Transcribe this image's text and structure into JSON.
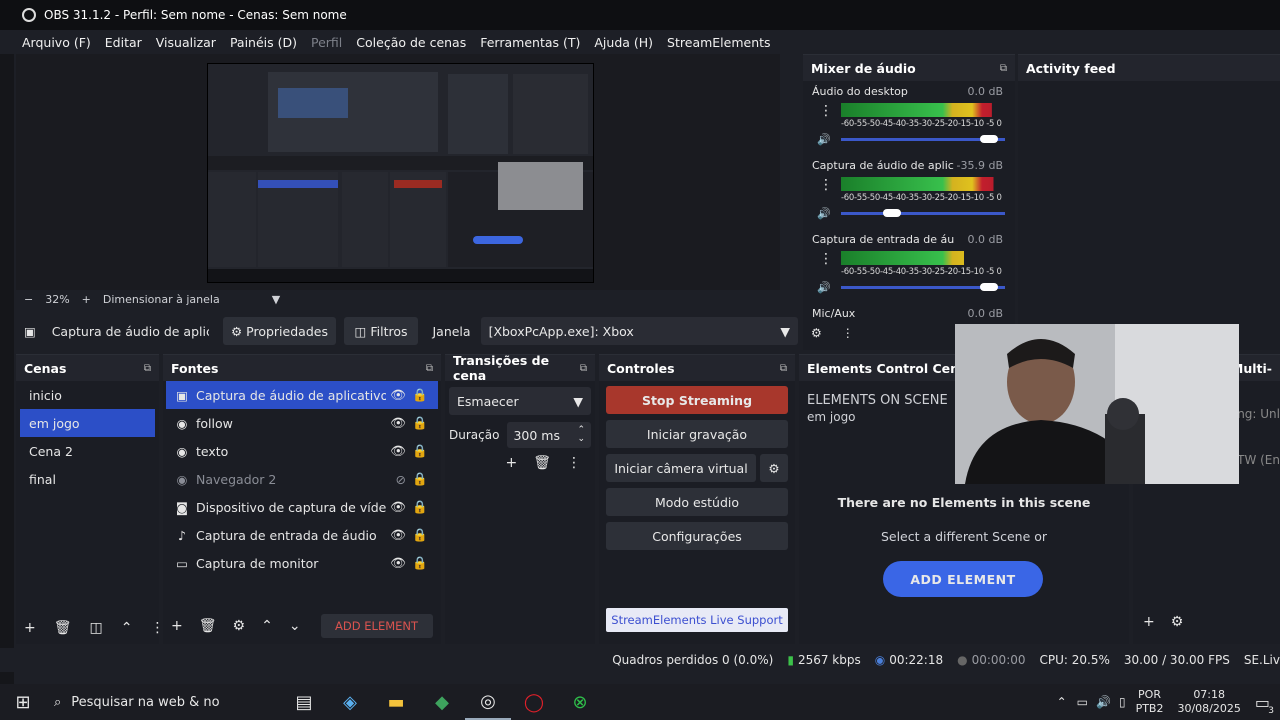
{
  "window": {
    "title": "OBS 31.1.2 - Perfil: Sem nome - Cenas: Sem nome"
  },
  "menu": [
    {
      "label": "Arquivo (F)",
      "disabled": false
    },
    {
      "label": "Editar",
      "disabled": false
    },
    {
      "label": "Visualizar",
      "disabled": false
    },
    {
      "label": "Painéis (D)",
      "disabled": false
    },
    {
      "label": "Perfil",
      "disabled": true
    },
    {
      "label": "Coleção de cenas",
      "disabled": false
    },
    {
      "label": "Ferramentas (T)",
      "disabled": false
    },
    {
      "label": "Ajuda (H)",
      "disabled": false
    },
    {
      "label": "StreamElements",
      "disabled": false
    }
  ],
  "zoom": {
    "minus": "−",
    "value": "32%",
    "plus": "+",
    "fit": "Dimensionar à janela"
  },
  "sourcebar": {
    "source_name": "Captura de áudio de aplicat",
    "properties": "Propriedades",
    "filters": "Filtros",
    "window_label": "Janela",
    "window_value": "[XboxPcApp.exe]: Xbox"
  },
  "mixer": {
    "title": "Mixer de áudio",
    "scale": "-60-55-50-45-40-35-30-25-20-15-10 -5  0",
    "tracks": [
      {
        "name": "Áudio do desktop",
        "db": "0.0 dB",
        "level": 0.92,
        "volume": 0.92,
        "muted": false
      },
      {
        "name": "Captura de áudio de aplicati",
        "db": "-35.9 dB",
        "level": 0.93,
        "volume": 0.33,
        "muted": false
      },
      {
        "name": "Captura de entrada de áudio",
        "db": "0.0 dB",
        "level": 0.75,
        "volume": 0.92,
        "muted": true
      },
      {
        "name": "Mic/Aux",
        "db": "0.0 dB",
        "level": 0,
        "volume": 0,
        "muted": false
      }
    ]
  },
  "activity": {
    "title": "Activity feed"
  },
  "scenes": {
    "title": "Cenas",
    "items": [
      {
        "label": "inicio",
        "selected": false
      },
      {
        "label": "em jogo",
        "selected": true
      },
      {
        "label": "Cena 2",
        "selected": false
      },
      {
        "label": "final",
        "selected": false
      }
    ]
  },
  "sources": {
    "title": "Fontes",
    "add_element": "ADD ELEMENT",
    "items": [
      {
        "label": "Captura de áudio de aplicativo (BE",
        "icon": "app-audio-icon",
        "selected": true,
        "visible": true
      },
      {
        "label": "follow",
        "icon": "browser-icon",
        "selected": false,
        "visible": true
      },
      {
        "label": "texto",
        "icon": "browser-icon",
        "selected": false,
        "visible": true
      },
      {
        "label": "Navegador 2",
        "icon": "browser-icon",
        "selected": false,
        "visible": false
      },
      {
        "label": "Dispositivo de captura de vídeo",
        "icon": "camera-icon",
        "selected": false,
        "visible": true
      },
      {
        "label": "Captura de entrada de áudio",
        "icon": "mic-icon",
        "selected": false,
        "visible": true
      },
      {
        "label": "Captura de monitor",
        "icon": "monitor-icon",
        "selected": false,
        "visible": true
      }
    ]
  },
  "transitions": {
    "title": "Transições de cena",
    "selected": "Esmaecer",
    "duration_label": "Duração",
    "duration_value": "300 ms"
  },
  "controls": {
    "title": "Controles",
    "stop_streaming": "Stop Streaming",
    "start_recording": "Iniciar gravação",
    "start_virtual_cam": "Iniciar câmera virtual",
    "studio_mode": "Modo estúdio",
    "settings": "Configurações",
    "support": "StreamElements Live Support"
  },
  "elements": {
    "title": "Elements Control Center",
    "on_scene": "ELEMENTS ON SCENE",
    "scene_name": "em jogo",
    "empty_msg": "There are no Elements in this scene",
    "hint": "Select a different Scene or",
    "add_button": "ADD ELEMENT"
  },
  "multi": {
    "title": "s Multi-",
    "line1": "ing: Unl",
    "line2": "mTW (En"
  },
  "status": {
    "dropped": "Quadros perdidos 0 (0.0%)",
    "bitrate": "2567 kbps",
    "stream_time": "00:22:18",
    "rec_time": "00:00:00",
    "cpu": "CPU: 20.5%",
    "fps": "30.00 / 30.00 FPS",
    "se": "SE.Liv"
  },
  "taskbar": {
    "search": "Pesquisar na web & no",
    "lang1": "POR",
    "lang2": "PTB2",
    "time": "07:18",
    "date": "30/08/2025",
    "notif_count": "3"
  }
}
